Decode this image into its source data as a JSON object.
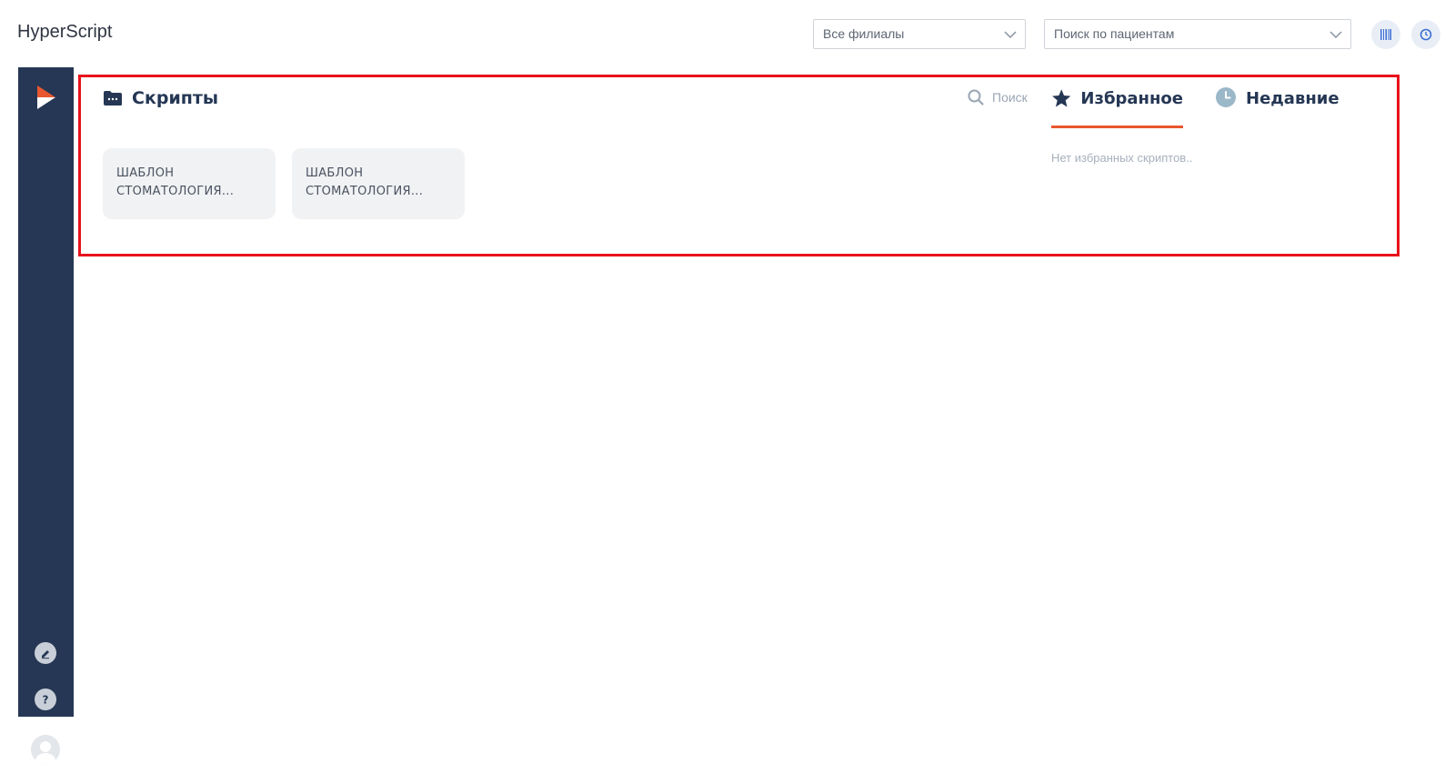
{
  "app": {
    "title": "HyperScript"
  },
  "header": {
    "branch_select": {
      "value": "Все филиалы"
    },
    "patient_search": {
      "placeholder": "Поиск по пациентам"
    },
    "barcode_button_icon": "barcode-icon",
    "history_button_icon": "clock-icon"
  },
  "sidebar": {
    "logo_icon": "chevron-logo",
    "items": [
      {
        "icon": "edit-icon"
      },
      {
        "icon": "help-icon"
      },
      {
        "icon": "avatar"
      }
    ]
  },
  "scripts": {
    "title": "Скрипты",
    "icon": "folder-icon",
    "cards": [
      {
        "line1": "ШАБЛОН",
        "line2": "СТОМАТОЛОГИЯ..."
      },
      {
        "line1": "ШАБЛОН",
        "line2": "СТОМАТОЛОГИЯ..."
      }
    ]
  },
  "right_panel": {
    "search_label": "Поиск",
    "tabs": [
      {
        "label": "Избранное",
        "icon": "star-icon",
        "active": true
      },
      {
        "label": "Недавние",
        "icon": "clock-icon",
        "active": false
      }
    ],
    "empty_text": "Нет избранных скриптов.."
  },
  "colors": {
    "sidebar": "#253754",
    "accent": "#e8572f",
    "highlight": "#e8121b"
  }
}
